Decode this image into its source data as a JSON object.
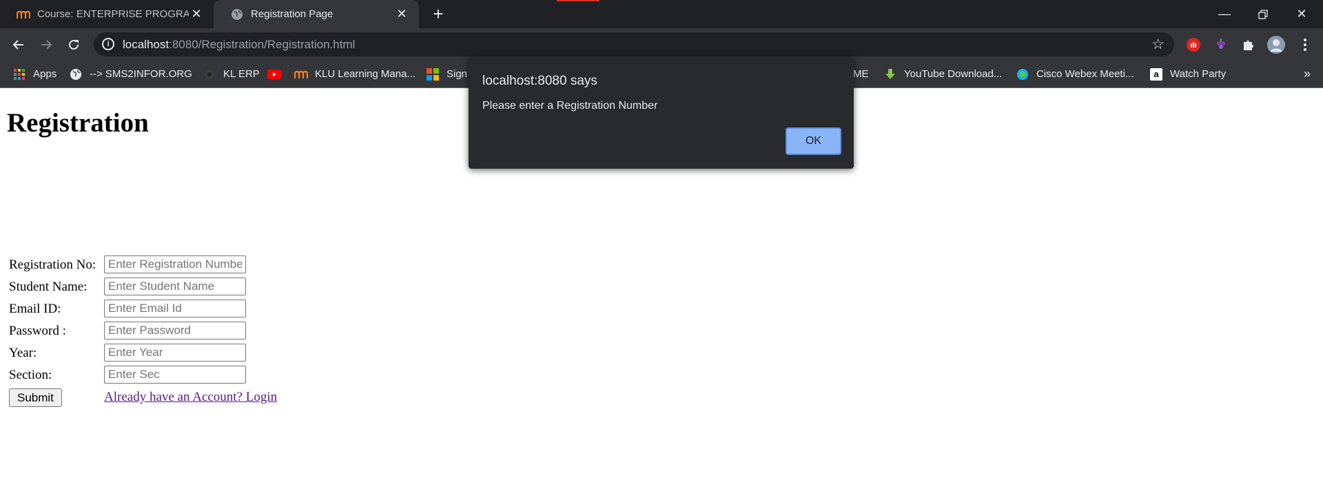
{
  "browser": {
    "tabs": [
      {
        "title": "Course: ENTERPRISE PROGRAMMING",
        "active": false
      },
      {
        "title": "Registration Page",
        "active": true
      }
    ],
    "address_host": "localhost",
    "address_rest": ":8080/Registration/Registration.html",
    "bookmarks": [
      "Apps",
      "--> SMS2INFOR.ORG",
      "KL ERP",
      "",
      "KLU Learning Mana...",
      "Sign",
      "ME",
      "YouTube Download...",
      "Cisco Webex Meeti...",
      "Watch Party"
    ]
  },
  "page": {
    "heading": "Registration",
    "fields": [
      {
        "label": "Registration No:",
        "placeholder": "Enter Registration Number",
        "value": ""
      },
      {
        "label": "Student Name:",
        "placeholder": "Enter Student Name",
        "value": ""
      },
      {
        "label": "Email ID:",
        "placeholder": "Enter Email Id",
        "value": ""
      },
      {
        "label": "Password :",
        "placeholder": "Enter Password",
        "value": ""
      },
      {
        "label": "Year:",
        "placeholder": "Enter Year",
        "value": ""
      },
      {
        "label": "Section:",
        "placeholder": "Enter Sec",
        "value": ""
      }
    ],
    "submit_label": "Submit",
    "login_link": "Already have an Account? Login"
  },
  "dialog": {
    "title": "localhost:8080 says",
    "message": "Please enter a Registration Number",
    "ok_label": "OK"
  },
  "colors": {
    "link_visited": "#551a8b",
    "dialog_button": "#8ab4f8",
    "chrome_dark": "#202124"
  }
}
